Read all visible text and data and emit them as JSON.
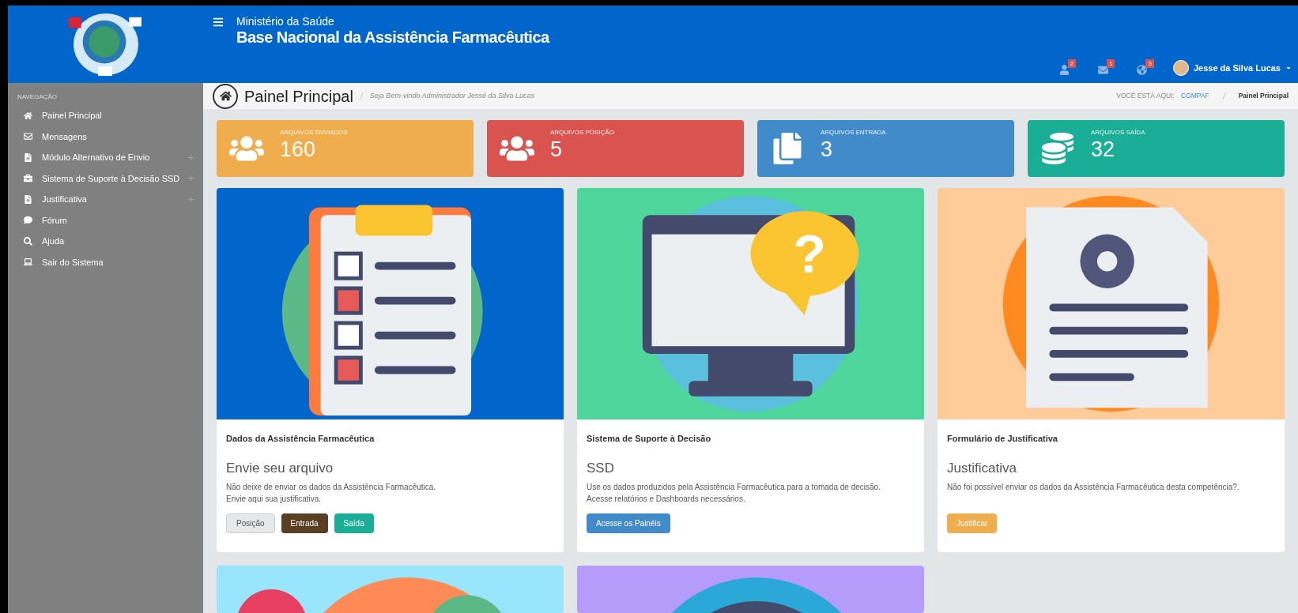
{
  "header": {
    "subtitle": "Ministério da Saúde",
    "title": "Base Nacional da Assistência Farmacêutica",
    "notifications": [
      {
        "kind": "user",
        "count": "2"
      },
      {
        "kind": "mail",
        "count": "1"
      },
      {
        "kind": "globe",
        "count": "5"
      }
    ],
    "user": "Jesse da Silva Lucas"
  },
  "sidebar": {
    "heading": "NAVEGAÇÃO",
    "items": [
      {
        "kind": "home",
        "label": "Painel Principal",
        "expandable": false
      },
      {
        "kind": "mail",
        "label": "Mensagens",
        "expandable": false
      },
      {
        "kind": "file",
        "label": "Módulo Alternativo de Envio",
        "expandable": true
      },
      {
        "kind": "briefcase",
        "label": "Sistema de Suporte à Decisão SSD",
        "expandable": true
      },
      {
        "kind": "file",
        "label": "Justificativa",
        "expandable": true
      },
      {
        "kind": "chat",
        "label": "Fórum",
        "expandable": false
      },
      {
        "kind": "search",
        "label": "Ajuda",
        "expandable": false
      },
      {
        "kind": "laptop",
        "label": "Sair do Sistema",
        "expandable": false
      }
    ]
  },
  "page_header": {
    "title": "Painel Principal",
    "welcome": "*Seja Bem-vindo Administrador* Jessé da Silva Lucas",
    "breadcrumb_label": "VOCÊ ESTÁ AQUI:",
    "breadcrumb": [
      "CGMPAF",
      "Painel Principal"
    ]
  },
  "stats": [
    {
      "kind": "users",
      "label": "ARQUIVOS ENVIADOS",
      "value": "160",
      "color": "#f0ad4e"
    },
    {
      "kind": "users",
      "label": "ARQUIVOS POSIÇÃO",
      "value": "5",
      "color": "#d9534f"
    },
    {
      "kind": "file",
      "label": "ARQUIVOS ENTRADA",
      "value": "3",
      "color": "#428bca"
    },
    {
      "kind": "money",
      "label": "ARQUIVOS SAÍDA",
      "value": "32",
      "color": "#1bae97"
    }
  ],
  "cards": [
    {
      "kind": "checklist",
      "heading": "Dados da Assistência Farmacêutica",
      "title": "Envie seu arquivo",
      "text": [
        "Não deixe de enviar os dados da Assistência Farmacêutica.",
        "Envie aqui sua justificativa."
      ],
      "buttons": [
        {
          "label": "Posição",
          "color": "#e6e8ea"
        },
        {
          "label": "Entrada",
          "color": "#5b3f24"
        },
        {
          "label": "Saída",
          "color": "#1bae97"
        }
      ]
    },
    {
      "kind": "monitor",
      "symbol": "?",
      "heading": "Sistema de Suporte à Decisão",
      "title": "SSD",
      "text": [
        "Use os dados produzidos pela Assistência Farmacêutica para a tomada de decisão.",
        "Acesse relatórios e Dashboards necessários."
      ],
      "buttons": [
        {
          "label": "Acesse os Painéis",
          "color": "#428bca"
        }
      ]
    },
    {
      "kind": "document",
      "heading": "Formulário de Justificativa",
      "title": "Justificativa",
      "text": [
        "Não foi possível enviar os dados da Assistência Farmacêutica desta competência?."
      ],
      "buttons": [
        {
          "label": "Justificar",
          "color": "#f0ad4e"
        }
      ]
    },
    {
      "kind": "circles"
    },
    {
      "kind": "person"
    }
  ]
}
